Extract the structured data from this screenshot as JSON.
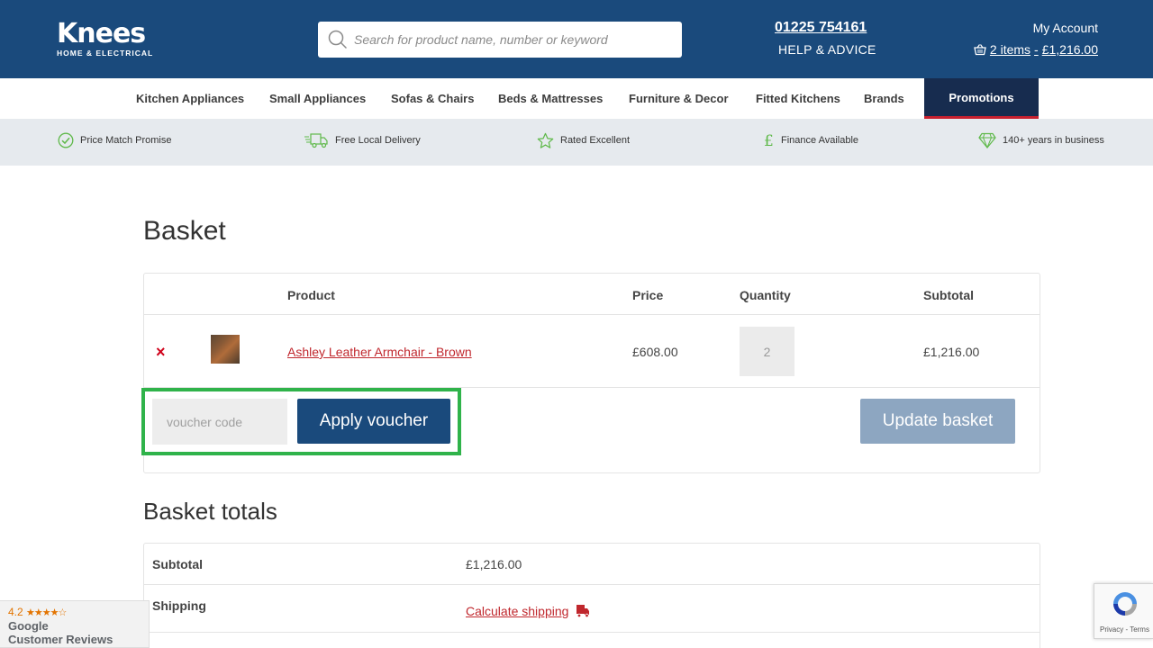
{
  "header": {
    "logo_main": "Knees",
    "logo_sub": "HOME & ELECTRICAL",
    "search_placeholder": "Search for product name, number or keyword",
    "phone": "01225 754161",
    "help": "HELP & ADVICE",
    "my_account": "My Account",
    "basket_items": "2 items",
    "basket_separator": "-",
    "basket_total": "£1,216.00"
  },
  "nav": {
    "items": [
      {
        "label": "Kitchen Appliances"
      },
      {
        "label": "Small Appliances"
      },
      {
        "label": "Sofas & Chairs"
      },
      {
        "label": "Beds & Mattresses"
      },
      {
        "label": "Furniture & Decor"
      },
      {
        "label": "Fitted Kitchens"
      },
      {
        "label": "Brands"
      },
      {
        "label": "Promotions"
      }
    ]
  },
  "usp": [
    {
      "label": "Price Match Promise",
      "icon": "check-circle-icon"
    },
    {
      "label": "Free Local Delivery",
      "icon": "truck-icon"
    },
    {
      "label": "Rated Excellent",
      "icon": "star-icon"
    },
    {
      "label": "Finance Available",
      "icon": "pound-icon"
    },
    {
      "label": "140+ years in business",
      "icon": "diamond-icon"
    }
  ],
  "basket": {
    "title": "Basket",
    "columns": {
      "product": "Product",
      "price": "Price",
      "quantity": "Quantity",
      "subtotal": "Subtotal"
    },
    "items": [
      {
        "remove": "×",
        "name": "Ashley Leather Armchair - Brown",
        "price": "£608.00",
        "quantity": "2",
        "subtotal": "£1,216.00"
      }
    ],
    "voucher_placeholder": "voucher code",
    "apply_label": "Apply voucher",
    "update_label": "Update basket"
  },
  "totals": {
    "title": "Basket totals",
    "subtotal_label": "Subtotal",
    "subtotal_value": "£1,216.00",
    "shipping_label": "Shipping",
    "shipping_link": "Calculate shipping"
  },
  "reviews_badge": {
    "rating": "4.2",
    "stars": "★★★★☆",
    "google": "Google",
    "text": "Customer Reviews"
  },
  "recaptcha": {
    "text": "Privacy - Terms"
  },
  "colors": {
    "brand_blue": "#1a4a7c",
    "promo_navy": "#172c4f",
    "accent_red": "#c0272d",
    "highlight_green": "#2fb34a",
    "usp_green": "#5fb94a"
  }
}
